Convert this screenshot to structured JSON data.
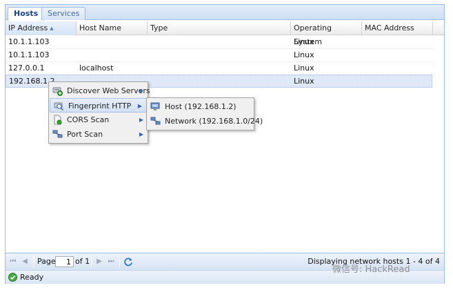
{
  "tabs": [
    {
      "label": "Hosts"
    },
    {
      "label": "Services"
    }
  ],
  "grid": {
    "columns": [
      "IP Address",
      "Host Name",
      "Type",
      "Operating System",
      "MAC Address"
    ],
    "rows": [
      {
        "ip": "10.1.1.103",
        "hostname": "",
        "type": "",
        "os": "Linux",
        "mac": ""
      },
      {
        "ip": "10.1.1.103",
        "hostname": "",
        "type": "",
        "os": "Linux",
        "mac": ""
      },
      {
        "ip": "127.0.0.1",
        "hostname": "localhost",
        "type": "",
        "os": "Linux",
        "mac": ""
      },
      {
        "ip": "192.168.1.2",
        "hostname": "",
        "type": "",
        "os": "Linux",
        "mac": ""
      }
    ]
  },
  "context_menu": {
    "items": [
      "Discover Web Servers",
      "Fingerprint HTTP",
      "CORS Scan",
      "Port Scan"
    ]
  },
  "submenu": {
    "items": [
      "Host (192.168.1.2)",
      "Network (192.168.1.0/24)"
    ]
  },
  "pager": {
    "page_label": "Page",
    "page_value": "1",
    "of_label": "of 1",
    "info": "Displaying network hosts 1 - 4 of 4"
  },
  "status": {
    "text": "Ready"
  },
  "watermark": {
    "text": "微信号: HackRead"
  }
}
